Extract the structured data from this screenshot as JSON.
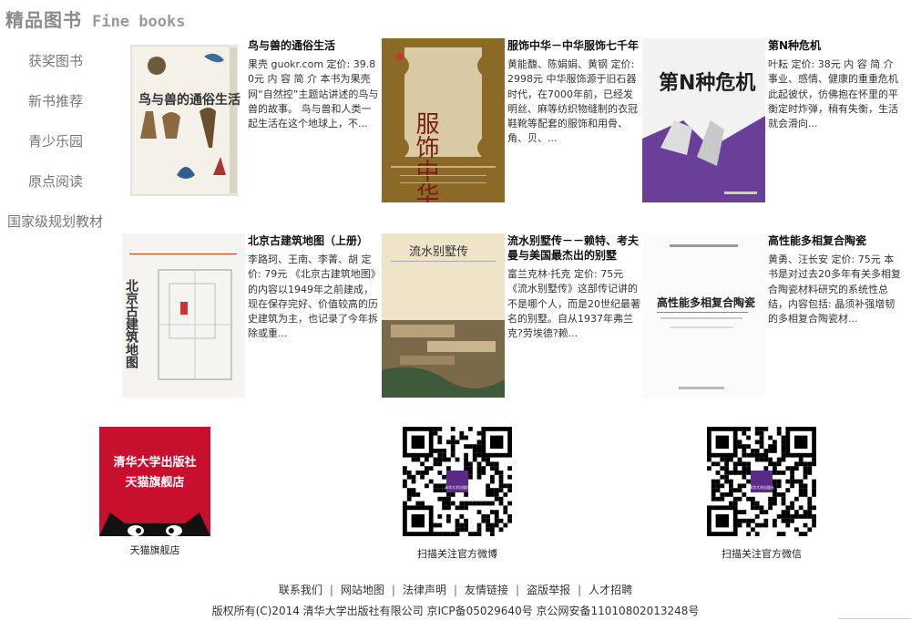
{
  "header": {
    "title_cn": "精品图书",
    "title_en": "Fine books"
  },
  "sidebar": {
    "items": [
      {
        "label": "获奖图书"
      },
      {
        "label": "新书推荐"
      },
      {
        "label": "青少乐园"
      },
      {
        "label": "原点阅读"
      },
      {
        "label": "国家级规划教材"
      }
    ]
  },
  "books": [
    {
      "title": "鸟与兽的通俗生活",
      "desc": "果壳 guokr.com 定价: 39.80元 内 容 简 介 本书为果壳网“自然控”主题站讲述的鸟与兽的故事。 鸟与兽和人类一起生活在这个地球上，不...",
      "cover_text": "鸟与兽的通俗生活"
    },
    {
      "title": "服饰中华－中华服饰七千年",
      "desc": "黄能馥、陈娟娟、黄钢 定价: 2998元 中华服饰源于旧石器时代，在7000年前，已经发明丝、麻等纺织物缝制的衣冠鞋靴等配套的服饰和用骨、角、贝、...",
      "cover_text": "服饰中华"
    },
    {
      "title": "第N种危机",
      "desc": "叶耘 定价: 38元 内 容 简 介 事业、感情、健康的重重危机此起彼伏，仿佛抱在怀里的平衡定时炸弹，稍有失衡，生活就会滑向...",
      "cover_text": "第N种危机"
    },
    {
      "title": "北京古建筑地图（上册）",
      "desc": "李路珂、王南、李菁、胡 定价: 79元 《北京古建筑地图》的内容以1949年之前建成，现在保存完好、价值较高的历史建筑为主，也记录了今年拆除或重...",
      "cover_text": "北京古建筑地图"
    },
    {
      "title": "流水别墅传－－赖特、考夫曼与美国最杰出的别墅",
      "desc": "富兰克林·托克 定价: 75元 《流水别墅传》这部传记讲的不是哪个人，而是20世纪最著名的别墅。自从1937年弗兰克?劳埃德?赖...",
      "cover_text": "流水别墅传"
    },
    {
      "title": "高性能多相复合陶瓷",
      "desc": "黄勇、汪长安 定价: 75元 本书是对过去20多年有关多相复合陶瓷材料研究的系统性总结，内容包括: 晶须补强增韧的多相复合陶瓷材...",
      "cover_text": "高性能多相复合陶瓷"
    }
  ],
  "store": {
    "logo_line1": "清华大学出版社",
    "logo_line2": "天猫旗舰店",
    "caption": "天猫旗舰店",
    "weibo_caption": "扫描关注官方微博",
    "weixin_caption": "扫描关注官方微信",
    "qr_center_text": "清华大学出版社"
  },
  "footer": {
    "links": [
      "联系我们",
      "网站地图",
      "法律声明",
      "友情链接",
      "盗版举报",
      "人才招聘"
    ],
    "copyright": "版权所有(C)2014 清华大学出版社有限公司 京ICP备05029640号 京公网安备11010802013248号"
  },
  "colors": {
    "tmall_red": "#c8102e",
    "sidebar_text": "#777777",
    "header_text": "#8a8a8a"
  }
}
